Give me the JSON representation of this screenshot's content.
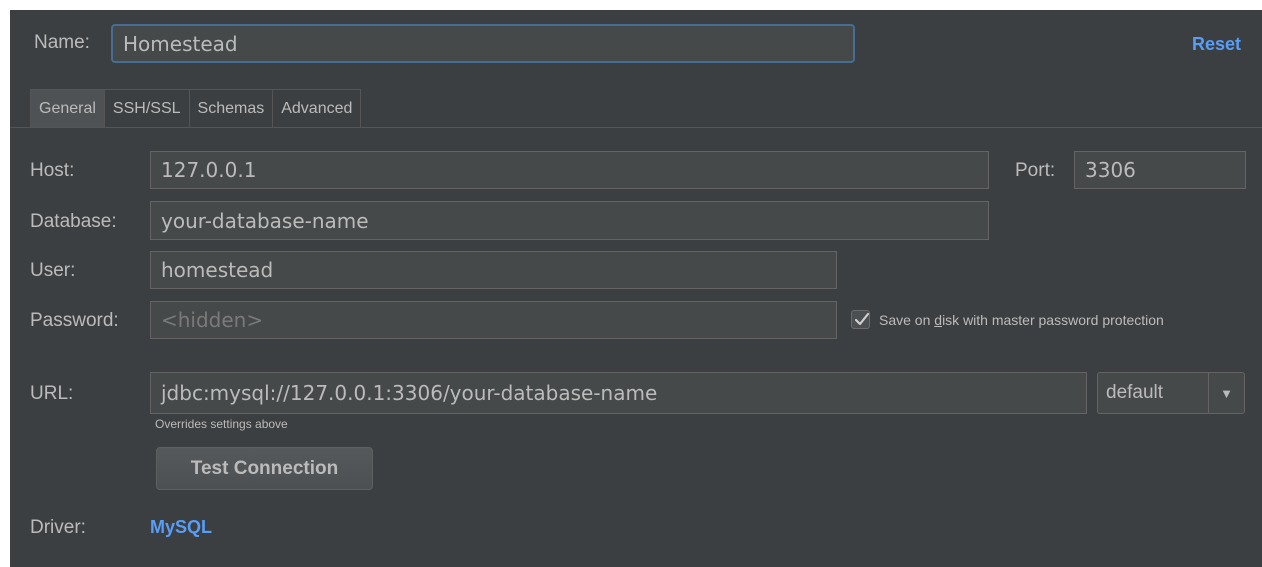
{
  "header": {
    "name_label": "Name:",
    "name_value": "Homestead",
    "reset_label": "Reset"
  },
  "tabs": [
    {
      "label": "General",
      "active": true
    },
    {
      "label": "SSH/SSL",
      "active": false
    },
    {
      "label": "Schemas",
      "active": false
    },
    {
      "label": "Advanced",
      "active": false
    }
  ],
  "form": {
    "host_label": "Host:",
    "host_value": "127.0.0.1",
    "port_label": "Port:",
    "port_value": "3306",
    "database_label": "Database:",
    "database_value": "your-database-name",
    "user_label": "User:",
    "user_value": "homestead",
    "password_label": "Password:",
    "password_placeholder": "<hidden>",
    "save_checked": true,
    "save_label_pre": "Save on ",
    "save_label_mnemonic": "d",
    "save_label_post": "isk with master password protection",
    "url_label": "URL:",
    "url_value": "jdbc:mysql://127.0.0.1:3306/your-database-name",
    "url_hint": "Overrides settings above",
    "url_mode": "default",
    "test_connection_label": "Test Connection",
    "driver_label": "Driver:",
    "driver_value": "MySQL"
  },
  "icons": {
    "combo_arrow": "chevron-down-icon",
    "checkbox_check": "checkmark-icon"
  },
  "colors": {
    "background": "#3c3f41",
    "field_background": "#45494a",
    "link": "#589df6",
    "focus_border": "#466d94",
    "text": "#bbbbbb"
  }
}
